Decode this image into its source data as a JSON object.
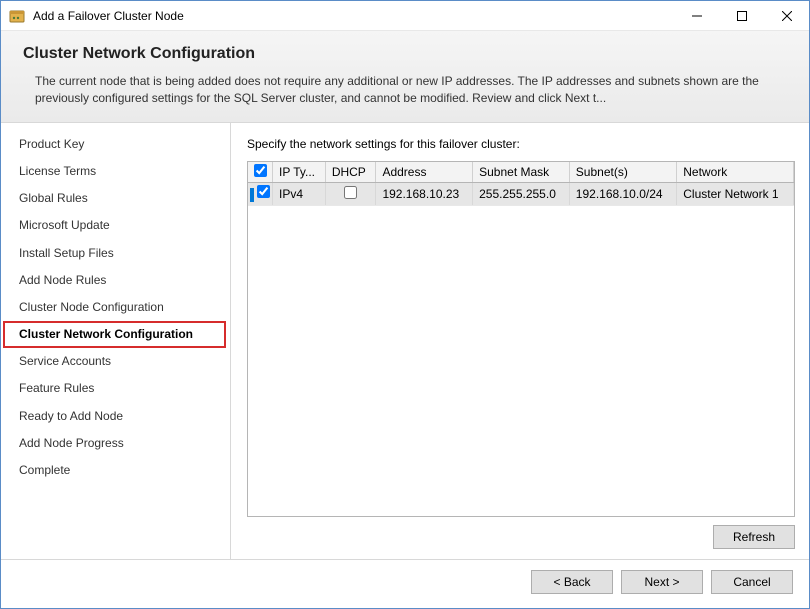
{
  "window": {
    "title": "Add a Failover Cluster Node"
  },
  "header": {
    "title": "Cluster Network Configuration",
    "description": "The current node that is being added does not require any additional or new IP addresses.  The IP addresses and subnets shown are the previously configured settings for the SQL Server cluster, and cannot be modified. Review and click Next t..."
  },
  "sidebar": {
    "items": [
      {
        "label": "Product Key"
      },
      {
        "label": "License Terms"
      },
      {
        "label": "Global Rules"
      },
      {
        "label": "Microsoft Update"
      },
      {
        "label": "Install Setup Files"
      },
      {
        "label": "Add Node Rules"
      },
      {
        "label": "Cluster Node Configuration"
      },
      {
        "label": "Cluster Network Configuration"
      },
      {
        "label": "Service Accounts"
      },
      {
        "label": "Feature Rules"
      },
      {
        "label": "Ready to Add Node"
      },
      {
        "label": "Add Node Progress"
      },
      {
        "label": "Complete"
      }
    ],
    "current_index": 7
  },
  "main": {
    "instruction": "Specify the network settings for this failover cluster:",
    "columns": {
      "check": "",
      "iptype": "IP Ty...",
      "dhcp": "DHCP",
      "address": "Address",
      "mask": "Subnet Mask",
      "subnets": "Subnet(s)",
      "network": "Network"
    },
    "rows": [
      {
        "checked": true,
        "iptype": "IPv4",
        "dhcp": false,
        "address": "192.168.10.23",
        "mask": "255.255.255.0",
        "subnets": "192.168.10.0/24",
        "network": "Cluster Network 1"
      }
    ],
    "refresh_label": "Refresh"
  },
  "footer": {
    "back": "< Back",
    "next": "Next >",
    "cancel": "Cancel"
  }
}
